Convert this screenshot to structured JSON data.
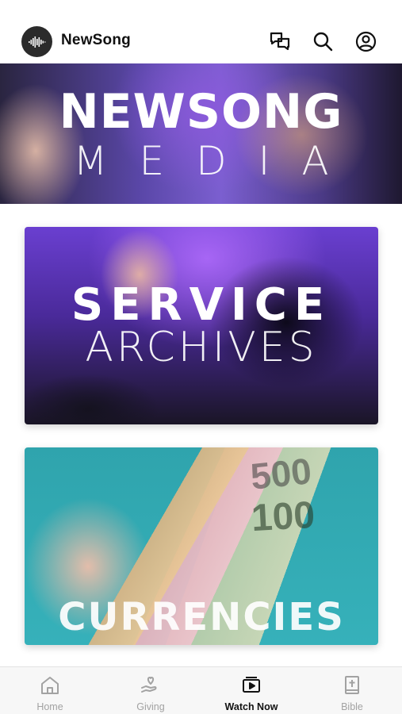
{
  "header": {
    "app_name": "NewSong",
    "icons": [
      "logo-icon",
      "chat-icon",
      "search-icon",
      "profile-icon"
    ]
  },
  "hero": {
    "line1": "NEWSONG",
    "line2": "MEDIA"
  },
  "cards": [
    {
      "line1": "SERVICE",
      "line2": "ARCHIVES"
    },
    {
      "line1": "CURRENCIES",
      "notes": [
        "500",
        "100"
      ]
    }
  ],
  "tabs": [
    {
      "label": "Home",
      "icon": "home-icon",
      "active": false
    },
    {
      "label": "Giving",
      "icon": "giving-icon",
      "active": false
    },
    {
      "label": "Watch Now",
      "icon": "watch-now-icon",
      "active": true
    },
    {
      "label": "Bible",
      "icon": "bible-icon",
      "active": false
    }
  ],
  "colors": {
    "header_bg": "#ffffff",
    "logo_bg": "#2b2b2b",
    "active_tab": "#111111",
    "inactive_tab": "#a2a2a2"
  }
}
